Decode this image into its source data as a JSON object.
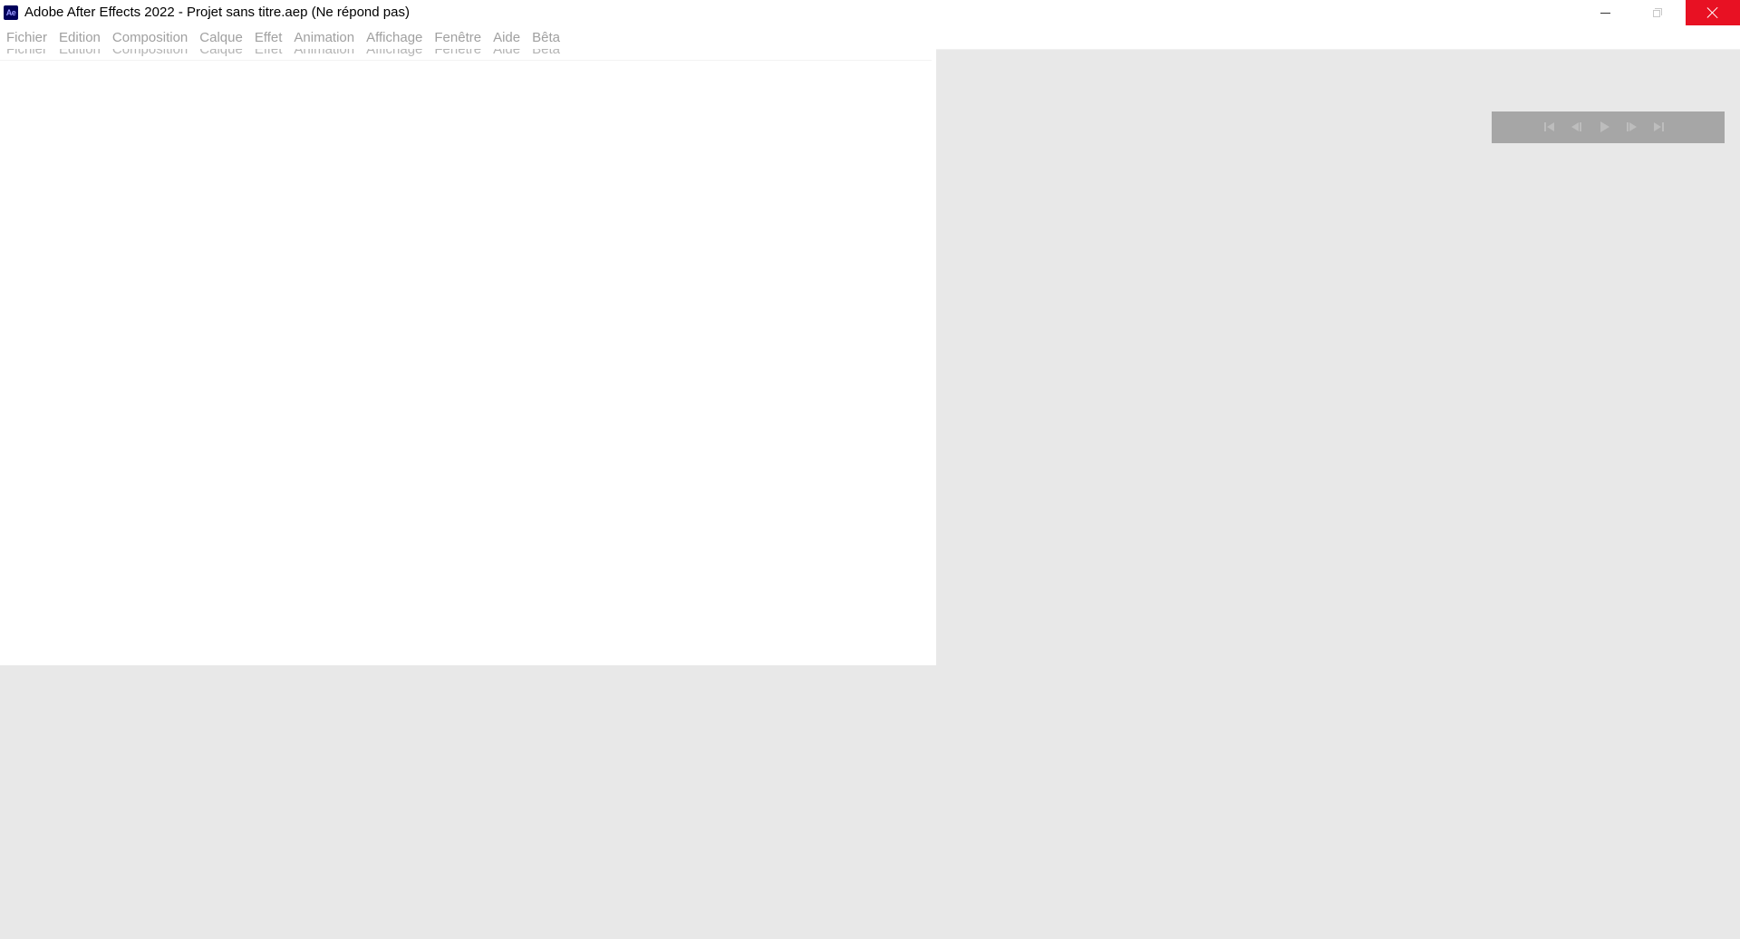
{
  "window": {
    "title": "Adobe After Effects 2022 - Projet sans titre.aep (Ne répond pas)",
    "app_icon_text": "Ae",
    "close_color": "#e81123"
  },
  "menubar": {
    "items": [
      {
        "label": "Fichier"
      },
      {
        "label": "Edition"
      },
      {
        "label": "Composition"
      },
      {
        "label": "Calque"
      },
      {
        "label": "Effet"
      },
      {
        "label": "Animation"
      },
      {
        "label": "Affichage"
      },
      {
        "label": "Fenêtre"
      },
      {
        "label": "Aide"
      },
      {
        "label": "Bêta"
      }
    ]
  },
  "playback": {
    "buttons": [
      {
        "icon": "first-frame-icon"
      },
      {
        "icon": "previous-frame-icon"
      },
      {
        "icon": "play-icon"
      },
      {
        "icon": "next-frame-icon"
      },
      {
        "icon": "last-frame-icon"
      }
    ]
  }
}
